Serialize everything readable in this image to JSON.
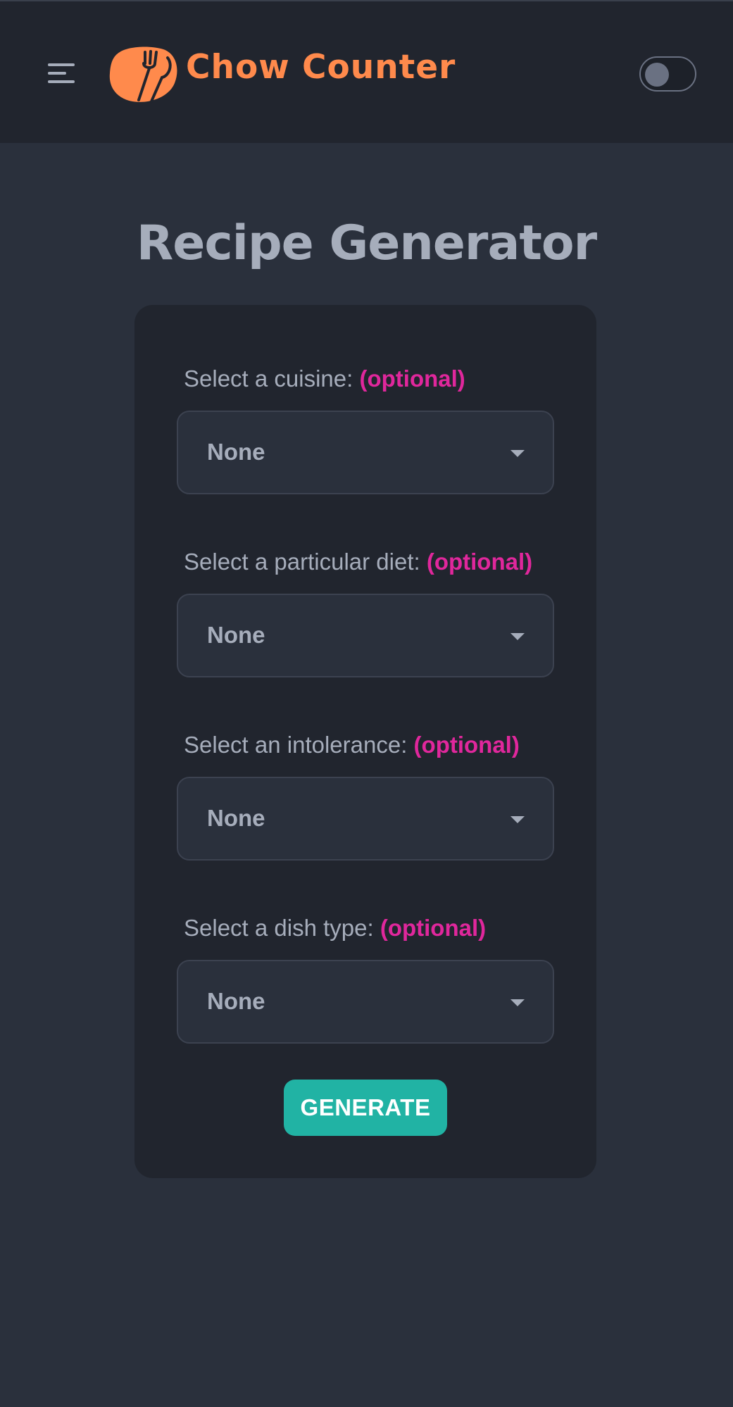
{
  "header": {
    "brand_name": "Chow Counter",
    "brand_color": "#ff8a4c",
    "menu_icon": "hamburger-menu-icon",
    "logo_icon": "fork-knife-icon",
    "theme_toggle_on": false
  },
  "main": {
    "title": "Recipe Generator",
    "fields": [
      {
        "label": "Select a cuisine:",
        "optional": "(optional)",
        "value": "None"
      },
      {
        "label": "Select a particular diet:",
        "optional": "(optional)",
        "value": "None"
      },
      {
        "label": "Select an intolerance:",
        "optional": "(optional)",
        "value": "None"
      },
      {
        "label": "Select a dish type:",
        "optional": "(optional)",
        "value": "None"
      }
    ],
    "generate_label": "GENERATE"
  },
  "colors": {
    "background": "#2a303c",
    "surface": "#21252e",
    "text": "#a6adbb",
    "optional_accent": "#e0279c",
    "primary_button": "#21b3a4"
  }
}
